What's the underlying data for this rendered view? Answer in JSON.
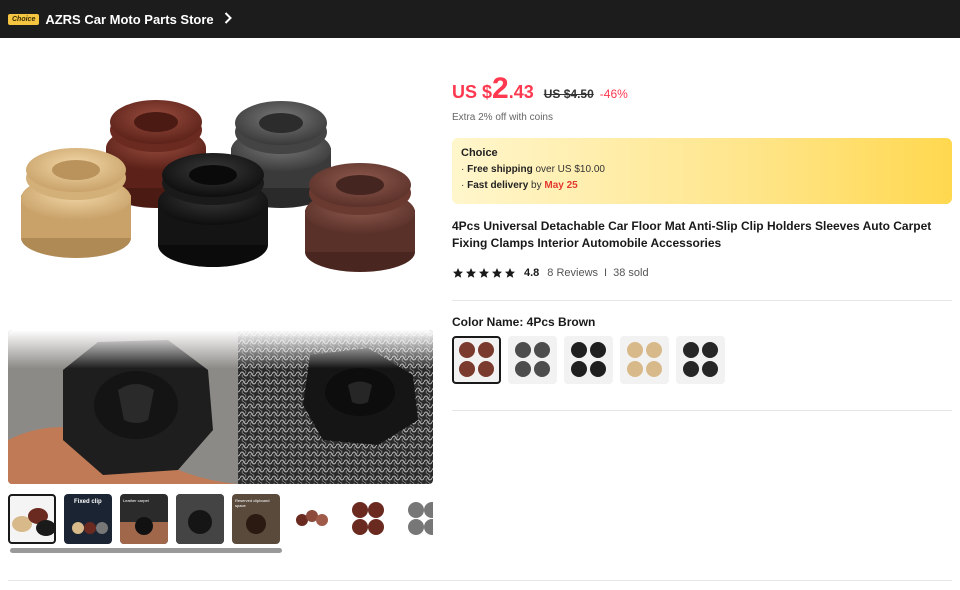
{
  "header": {
    "choice_badge": "Choice",
    "store_name": "AZRS Car Moto Parts Store",
    "chevron_icon": "chevron-right-icon"
  },
  "price": {
    "currency_prefix": "US $",
    "integer": "2",
    "decimal": ".43",
    "old_price": "US $4.50",
    "discount": "-46%",
    "coins_note": "Extra 2% off with coins"
  },
  "choice": {
    "title": "Choice",
    "shipping_bold": "Free shipping",
    "shipping_rest": " over US $10.00",
    "delivery_bold": "Fast delivery",
    "delivery_by": " by ",
    "delivery_date": "May 25"
  },
  "product": {
    "title": "4Pcs Universal Detachable Car Floor Mat Anti-Slip Clip Holders Sleeves Auto Carpet Fixing Clamps Interior Automobile Accessories",
    "rating": "4.8",
    "stars": 5,
    "reviews": "8 Reviews",
    "separator": "I",
    "sold": "38 sold"
  },
  "color": {
    "label": "Color Name: 4Pcs Brown",
    "options": [
      {
        "name": "brown",
        "color": "#7a3a2e"
      },
      {
        "name": "gray",
        "color": "#4d4d4d"
      },
      {
        "name": "black",
        "color": "#1f1f1f"
      },
      {
        "name": "beige",
        "color": "#d8b98a"
      },
      {
        "name": "black-2",
        "color": "#262626"
      }
    ],
    "selected_index": 0
  },
  "thumbnails": {
    "labels": [
      "",
      "Fixed clip",
      "Leather carpet",
      "",
      "Reserved clipboard space",
      "",
      "",
      ""
    ]
  },
  "colors": {
    "accent": "#fd384f",
    "header_bg": "#1c1c1c",
    "star": "#191919"
  }
}
